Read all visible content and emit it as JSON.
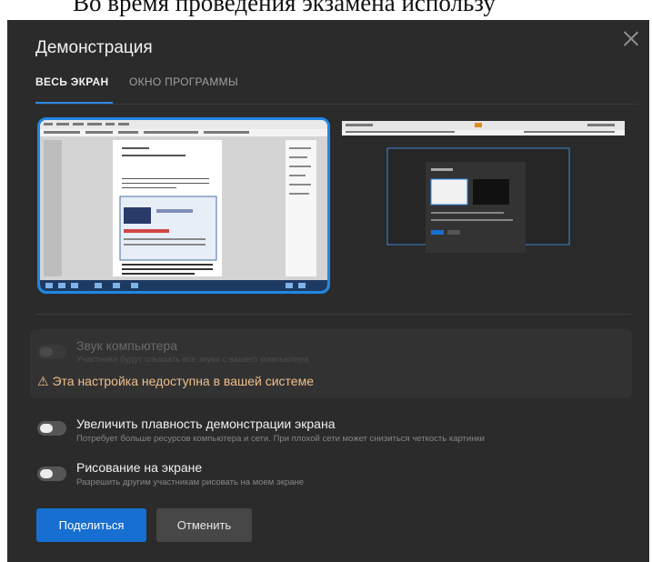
{
  "background_document": {
    "text": "Во время проведения экзамена использу"
  },
  "dialog": {
    "title": "Демонстрация",
    "tabs": [
      {
        "label": "ВЕСЬ ЭКРАН",
        "active": true
      },
      {
        "label": "ОКНО ПРОГРАММЫ",
        "active": false
      }
    ],
    "screens": [
      {
        "name": "screen-1",
        "selected": true
      },
      {
        "name": "screen-2",
        "selected": false
      }
    ],
    "computer_sound": {
      "title": "Звук компьютера",
      "description": "Участники будут слышать все звуки с вашего компьютера",
      "enabled": false,
      "available": false
    },
    "warning": {
      "icon": "warning-triangle-icon",
      "text": "Эта настройка недоступна в вашей системе"
    },
    "smooth_demo": {
      "title": "Увеличить плавность демонстрации экрана",
      "description": "Потребует больше ресурсов компьютера и сети. При плохой сети может снизиться четкость картинки",
      "enabled": false
    },
    "drawing": {
      "title": "Рисование на экране",
      "description": "Разрешить другим участникам рисовать на моем экране",
      "enabled": false
    },
    "buttons": {
      "share": "Поделиться",
      "cancel": "Отменить"
    }
  },
  "colors": {
    "dialog_bg": "#2b2b2c",
    "accent": "#2187e3",
    "primary_button": "#1770d1",
    "warning": "#f0bf8a"
  }
}
